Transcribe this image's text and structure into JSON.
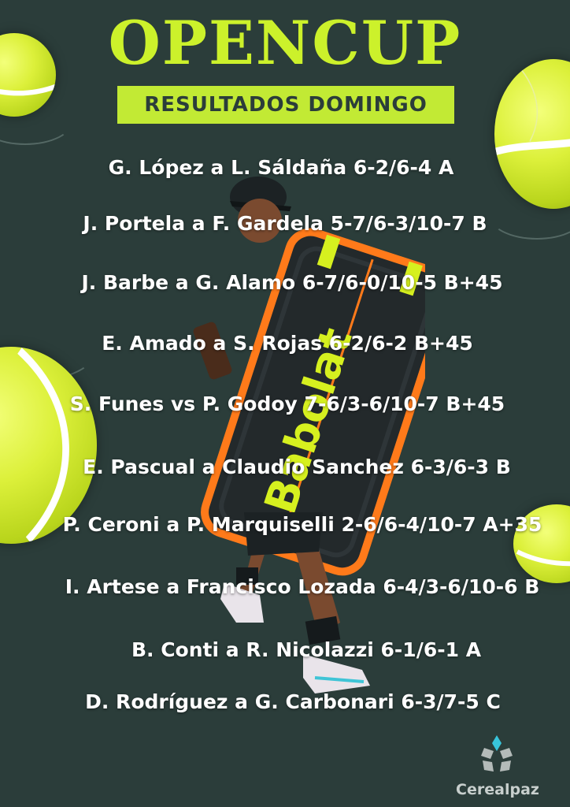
{
  "poster": {
    "title": "OPENCUP",
    "subtitle": "RESULTADOS DOMINGO",
    "results": [
      "G. López a L. Sáldaña 6-2/6-4 A",
      "J. Portela a F. Gardela 5-7/6-3/10-7 B",
      "J. Barbe a G. Alamo 6-7/6-0/10-5 B+45",
      "E. Amado a S. Rojas 6-2/6-2 B+45",
      "S. Funes vs P. Godoy 7-6/3-6/10-7 B+45",
      "E. Pascual a Claudio Sanchez 6-3/6-3 B",
      "P. Ceroni a P. Marquiselli 2-6/6-4/10-7 A+35",
      "I. Artese a Francisco Lozada 6-4/3-6/10-6 B",
      "B. Conti a R. Nicolazzi 6-1/6-1 A",
      "D. Rodríguez a G. Carbonari  6-3/7-5 C"
    ],
    "sponsor": "Cerealpaz"
  },
  "colors": {
    "background": "#2b3d3a",
    "accent": "#ccf12b",
    "subtitle_bg": "#c2ea34",
    "text": "#ffffff"
  },
  "icons": [
    "tennis-ball-icon",
    "tennis-player-image",
    "cerealpaz-logo-icon"
  ]
}
